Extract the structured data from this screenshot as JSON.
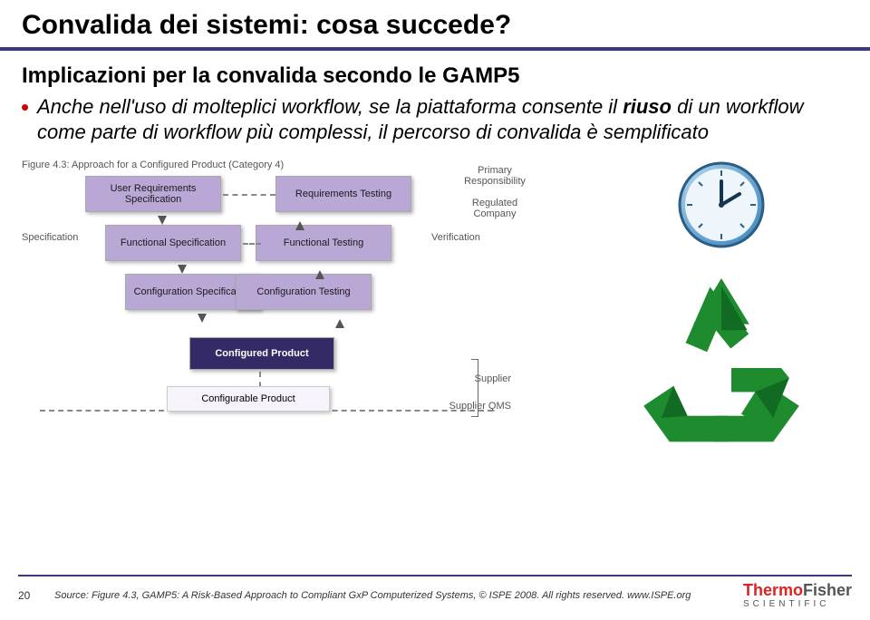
{
  "title": "Convalida dei sistemi: cosa succede?",
  "subtitle": "Implicazioni per la convalida secondo le GAMP5",
  "bullet": {
    "pre": "Anche nell'uso di molteplici workflow, se la piattaforma consente il ",
    "bold": "riuso",
    "post": " di un workflow come parte di workflow più complessi, il percorso di convalida è semplificato"
  },
  "figure": {
    "caption": "Figure 4.3: Approach for a Configured Product (Category 4)",
    "primary_responsibility": "Primary Responsibility",
    "regulated_company": "Regulated Company",
    "specification_label": "Specification",
    "verification_label": "Verification",
    "left_boxes": [
      "User Requirements Specification",
      "Functional Specification",
      "Configuration Specification"
    ],
    "right_boxes": [
      "Requirements Testing",
      "Functional Testing",
      "Configuration Testing"
    ],
    "bottom_box": "Configured Product",
    "configurable_product": "Configurable Product",
    "supplier": "Supplier",
    "supplier_qms": "Supplier QMS"
  },
  "footer": {
    "slide_number": "20",
    "source": "Source: Figure 4.3, GAMP5: A Risk-Based Approach to Compliant GxP Computerized Systems, © ISPE 2008. All rights reserved. www.ISPE.org",
    "logo_thermo": "Thermo",
    "logo_fisher": "Fisher",
    "logo_sub": "SCIENTIFIC"
  }
}
